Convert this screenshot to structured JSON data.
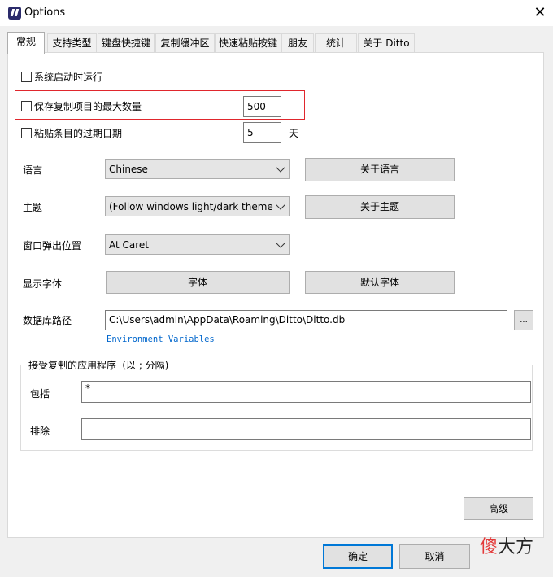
{
  "window": {
    "title": "Options",
    "close_label": "✕"
  },
  "tabs": [
    "常规",
    "支持类型",
    "键盘快捷键",
    "复制缓冲区",
    "快速粘贴按键",
    "朋友",
    "统计",
    "关于 Ditto"
  ],
  "general": {
    "run_on_startup": {
      "label": "系统启动时运行",
      "checked": false
    },
    "max_saved": {
      "label": "保存复制项目的最大数量",
      "checked": false,
      "value": "500"
    },
    "expire": {
      "label": "粘贴条目的过期日期",
      "checked": false,
      "value": "5",
      "unit": "天"
    },
    "language": {
      "label": "语言",
      "value": "Chinese",
      "button": "关于语言"
    },
    "theme": {
      "label": "主题",
      "value": "(Follow windows light/dark themes)",
      "button": "关于主题"
    },
    "popup": {
      "label": "窗口弹出位置",
      "value": "At Caret"
    },
    "font": {
      "label": "显示字体",
      "font_button": "字体",
      "default_button": "默认字体"
    },
    "db_path": {
      "label": "数据库路径",
      "value": "C:\\Users\\admin\\AppData\\Roaming\\Ditto\\Ditto.db",
      "browse": "...",
      "env_link": "Environment Variables"
    },
    "apps": {
      "title": "接受复制的应用程序（以 ; 分隔)",
      "include_label": "包括",
      "include_value": "*",
      "exclude_label": "排除",
      "exclude_value": ""
    },
    "advanced": "高级"
  },
  "footer": {
    "ok": "确定",
    "cancel": "取消"
  },
  "watermark": {
    "part1": "傻",
    "part2": "大方"
  },
  "colors": {
    "highlight": "#e0272d",
    "link": "#0066cc",
    "focus": "#0078d7"
  }
}
